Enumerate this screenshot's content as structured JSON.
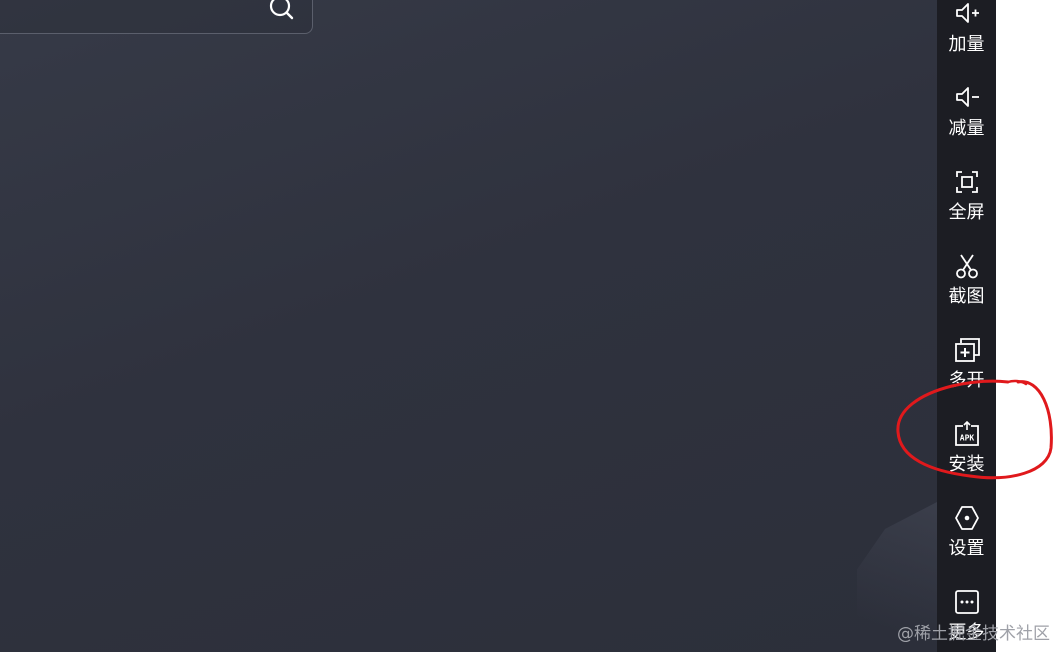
{
  "toolbar": {
    "items": [
      {
        "label": "加量",
        "icon": "volume-up-icon"
      },
      {
        "label": "减量",
        "icon": "volume-down-icon"
      },
      {
        "label": "全屏",
        "icon": "fullscreen-icon"
      },
      {
        "label": "截图",
        "icon": "scissors-icon"
      },
      {
        "label": "多开",
        "icon": "multi-instance-icon"
      },
      {
        "label": "安装",
        "icon": "apk-install-icon"
      },
      {
        "label": "设置",
        "icon": "settings-hex-icon"
      },
      {
        "label": "更多",
        "icon": "more-icon"
      }
    ]
  },
  "search": {
    "icon": "search-icon"
  },
  "watermark": "@稀土掘金技术社区",
  "colors": {
    "screen_bg": "#30333f",
    "toolbar_bg": "#1c1d23",
    "annotation": "#e0191c",
    "icon": "#ffffff"
  }
}
